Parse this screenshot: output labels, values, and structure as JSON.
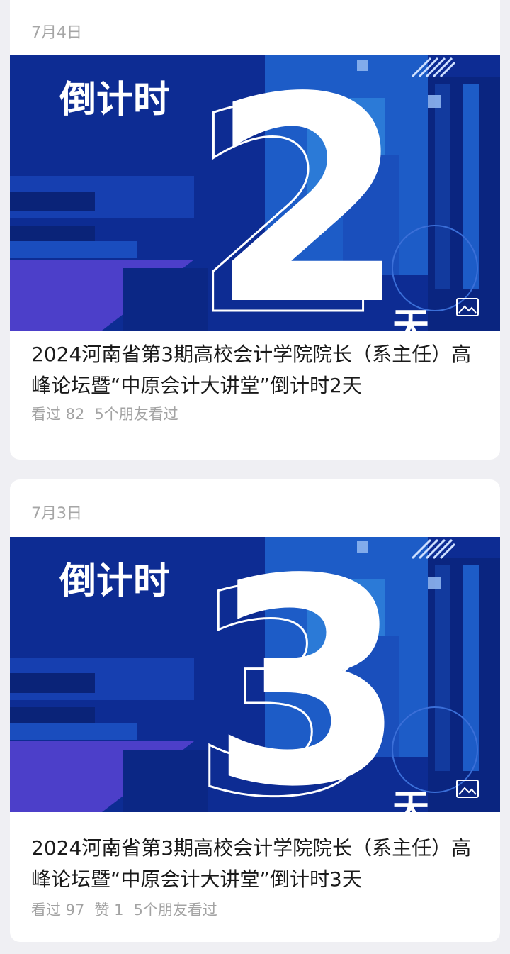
{
  "articles": [
    {
      "date": "7月4日",
      "cover": {
        "headline": "倒计时",
        "number": "2",
        "unit": "天",
        "image_icon": "image-icon"
      },
      "title": "2024河南省第3期高校会计学院院长（系主任）高峰论坛暨“中原会计大讲堂”倒计时2天",
      "meta": {
        "views": "看过 82",
        "friends": "5个朋友看过"
      }
    },
    {
      "date": "7月3日",
      "cover": {
        "headline": "倒计时",
        "number": "3",
        "unit": "天",
        "image_icon": "image-icon"
      },
      "title": "2024河南省第3期高校会计学院院长（系主任）高峰论坛暨“中原会计大讲堂”倒计时3天",
      "meta": {
        "views": "看过 97",
        "likes": "赞 1",
        "friends": "5个朋友看过"
      }
    }
  ],
  "colors": {
    "background": "#efeff3",
    "card": "#ffffff",
    "cover_dark": "#0b2a8f",
    "cover_mid": "#1b4fc0",
    "cover_light": "#2a78d6",
    "accent_purple": "#5a4bd6"
  }
}
